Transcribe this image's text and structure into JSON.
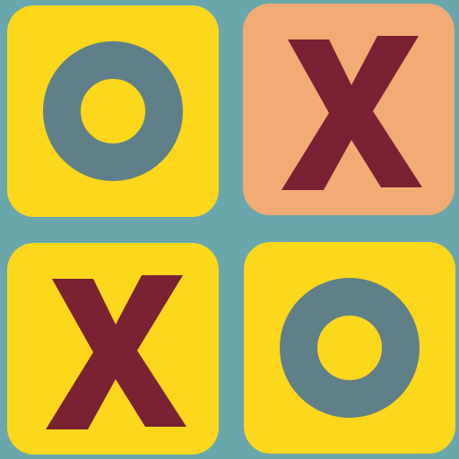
{
  "board": {
    "background_color": "#6aa7ac",
    "tiles": [
      {
        "mark": "O",
        "tile_color": "#fdd71c",
        "mark_color": "#5f8089",
        "icon": "o-mark-icon"
      },
      {
        "mark": "X",
        "tile_color": "#f2ab75",
        "mark_color": "#7a2133",
        "icon": "x-mark-icon"
      },
      {
        "mark": "X",
        "tile_color": "#fdd71c",
        "mark_color": "#7a2133",
        "icon": "x-mark-icon"
      },
      {
        "mark": "O",
        "tile_color": "#fdd71c",
        "mark_color": "#5f8089",
        "icon": "o-mark-icon"
      }
    ]
  }
}
